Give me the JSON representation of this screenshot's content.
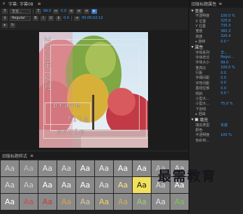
{
  "left_panel": {
    "tab_title": "字幕: 字幕08",
    "menu_glyph": "≡"
  },
  "toolbar": {
    "font_family": "华文...",
    "font_style": "Regular",
    "font_size": "99.0",
    "kerning": "0.0",
    "leading": "0.0",
    "timecode": "00:00:02:12",
    "bold": "B",
    "italic": "I",
    "underline": "U",
    "text_tool": "T",
    "align_left": "≡"
  },
  "canvas": {
    "vertical_text": "2020年12月",
    "brave": "brave",
    "film": "film",
    "movie": "movie"
  },
  "styles_panel": {
    "title": "旧版标题样式",
    "menu_glyph": "≡",
    "swatch_label": "Aa",
    "swatch_colors": [
      "#cfcfcf",
      "#bdbdbd",
      "#eaeaea",
      "#dddddd",
      "#ffffff",
      "#f0f0f0",
      "#ffffff",
      "#ffffff",
      "#c8c8c8",
      "#e0e0e0",
      "#dcdcdc",
      "#cccccc",
      "#ffffff",
      "#f2f2f2",
      "#ffffff",
      "#e6e6e6",
      "#ffe08a",
      "#1a1a1a",
      "#d9d9d9",
      "#ffffff",
      "#ffffff",
      "#d04a4a",
      "#c83c3c",
      "#e0a04a",
      "#d8c8a0",
      "#f0d060",
      "#c8b060",
      "#9fd06a",
      "#e0e0e0",
      "#7ac84a"
    ]
  },
  "right_panel": {
    "title": "旧版标题属性",
    "menu_glyph": "≡",
    "section_transform": "变换",
    "transform_rows": [
      {
        "label": "不透明度",
        "value": "100.0 %"
      },
      {
        "label": "X 位置",
        "value": "325.9"
      },
      {
        "label": "Y 位置",
        "value": "735.3"
      },
      {
        "label": "宽度",
        "value": "382.3"
      },
      {
        "label": "高度",
        "value": "320.4"
      },
      {
        "label": "▸ 旋转",
        "value": "0.0 °"
      }
    ],
    "section_properties": "属性",
    "property_rows": [
      {
        "label": "字体系列",
        "value": "华..."
      },
      {
        "label": "字体样式",
        "value": "Regul..."
      },
      {
        "label": "字体大小",
        "value": "99.0"
      },
      {
        "label": "宽高比",
        "value": "100.0 %"
      },
      {
        "label": "行距",
        "value": "0.0"
      },
      {
        "label": "字偶间距",
        "value": "0.0"
      },
      {
        "label": "字符间距",
        "value": "0.0"
      },
      {
        "label": "基线位移",
        "value": "0.0"
      },
      {
        "label": "倾斜",
        "value": "0.0 °"
      },
      {
        "label": "小型大...",
        "value": ""
      },
      {
        "label": "小型大...",
        "value": "75.0 %"
      },
      {
        "label": "下划线",
        "value": ""
      },
      {
        "label": "▸ 扭曲",
        "value": ""
      }
    ],
    "section_fill": "填充",
    "fill_rows": [
      {
        "label": "填充类型",
        "value": "实底"
      },
      {
        "label": "颜色",
        "value": ""
      },
      {
        "label": "不透明度",
        "value": "100 %"
      },
      {
        "label": "色彩到...",
        "value": ""
      }
    ]
  },
  "watermark": "最需教育",
  "accent_color": "#3aa0ff"
}
